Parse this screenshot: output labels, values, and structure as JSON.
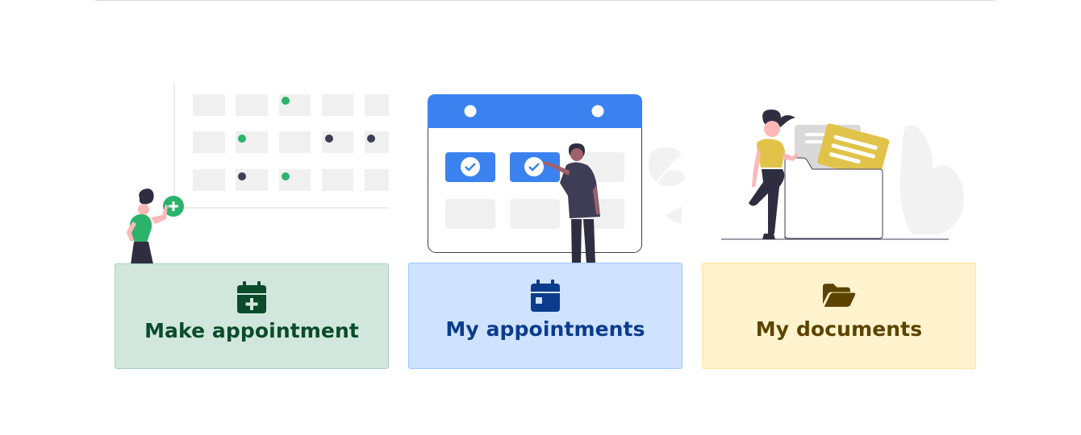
{
  "cards": [
    {
      "label": "Make appointment",
      "icon": "calendar-plus-icon",
      "background": "#d1e7dd",
      "border": "#a3cfbb",
      "text_color": "#0a4b2c"
    },
    {
      "label": "My appointments",
      "icon": "calendar-icon",
      "background": "#cfe2ff",
      "border": "#9ec5fe",
      "text_color": "#0b3c8c"
    },
    {
      "label": "My documents",
      "icon": "folder-open-icon",
      "background": "#fff3cd",
      "border": "#ffe69c",
      "text_color": "#5c4300"
    }
  ],
  "colors": {
    "green_accent": "#2bb36b",
    "blue_accent": "#3b82f0",
    "yellow_accent": "#e2c34a",
    "dark_figure": "#3f3d56",
    "placeholder_gray": "#f0f0f0"
  }
}
